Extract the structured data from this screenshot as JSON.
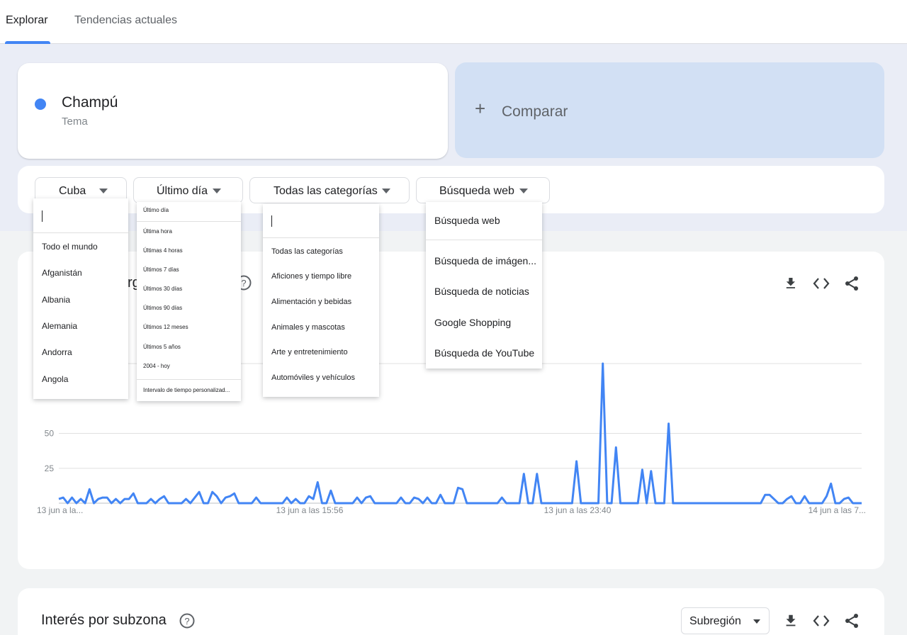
{
  "tabs": {
    "explore": "Explorar",
    "trending": "Tendencias actuales"
  },
  "term": {
    "name": "Champú",
    "type": "Tema",
    "color": "#4285f4"
  },
  "compare": {
    "label": "Comparar",
    "icon": "plus-icon"
  },
  "filters": {
    "region": "Cuba",
    "time": "Último día",
    "category": "Todas las categorías",
    "search_type": "Búsqueda web"
  },
  "region_menu": {
    "items": [
      "Todo el mundo",
      "Afganistán",
      "Albania",
      "Alemania",
      "Andorra",
      "Angola"
    ]
  },
  "time_menu": {
    "current": "Último día",
    "items": [
      "Última hora",
      "Últimas 4 horas",
      "Últimos 7 días",
      "Últimos 30 días",
      "Últimos 90 días",
      "Últimos 12 meses",
      "Últimos 5 años",
      "2004 - hoy"
    ],
    "custom": "Intervalo de tiempo personalizad..."
  },
  "category_menu": {
    "items": [
      "Todas las categorías",
      "Aficiones y tiempo libre",
      "Alimentación y bebidas",
      "Animales y mascotas",
      "Arte y entretenimiento",
      "Automóviles y vehículos"
    ]
  },
  "search_type_menu": {
    "current": "Búsqueda web",
    "items": [
      "Búsqueda de imágen...",
      "Búsqueda de noticias",
      "Google Shopping",
      "Búsqueda de YouTube"
    ]
  },
  "chart_section": {
    "title_fragment": "rg",
    "icons": [
      "download-icon",
      "embed-code-icon",
      "share-icon"
    ]
  },
  "chart_data": {
    "type": "line",
    "series": [
      {
        "values": [
          3,
          4,
          0,
          4,
          0,
          3,
          0,
          10,
          0,
          3,
          4,
          4,
          0,
          3,
          0,
          3,
          3,
          7,
          0,
          0,
          0,
          3,
          0,
          3,
          5,
          0,
          0,
          0,
          0,
          3,
          0,
          4,
          8,
          0,
          0,
          8,
          5,
          0,
          4,
          5,
          7,
          0,
          0,
          0,
          0,
          4,
          0,
          0,
          0,
          0,
          0,
          0,
          4,
          0,
          3,
          0,
          0,
          5,
          3,
          15,
          0,
          0,
          9,
          0,
          0,
          0,
          0,
          0,
          4,
          0,
          4,
          5,
          0,
          0,
          0,
          0,
          0,
          0,
          4,
          0,
          0,
          4,
          3,
          0,
          4,
          0,
          0,
          6,
          0,
          0,
          0,
          11,
          10,
          0,
          0,
          0,
          0,
          0,
          0,
          0,
          0,
          4,
          0,
          0,
          0,
          0,
          21,
          0,
          0,
          21,
          0,
          0,
          0,
          0,
          0,
          0,
          0,
          0,
          30,
          0,
          0,
          0,
          0,
          0,
          100,
          0,
          0,
          40,
          0,
          0,
          0,
          0,
          0,
          24,
          0,
          23,
          0,
          0,
          0,
          57,
          0,
          0,
          0,
          0,
          0,
          0,
          0,
          0,
          0,
          0,
          0,
          0,
          0,
          0,
          0,
          0,
          0,
          0,
          0,
          0,
          0,
          6,
          6,
          3,
          0,
          0,
          3,
          5,
          0,
          0,
          5,
          0,
          0,
          0,
          0,
          5,
          14,
          0,
          0,
          3,
          4,
          0,
          0,
          0
        ]
      }
    ],
    "color": "#4285f4",
    "yticks": [
      25,
      50
    ],
    "ylim": [
      0,
      100
    ],
    "xtick_labels": [
      "13 jun a la...",
      "13 jun a las 15:56",
      "13 jun a las 23:40",
      "14 jun a las 7..."
    ],
    "grid": true
  },
  "subregion": {
    "title": "Interés por subzona",
    "select_value": "Subregión",
    "icons": [
      "download-icon",
      "embed-code-icon",
      "share-icon"
    ]
  }
}
